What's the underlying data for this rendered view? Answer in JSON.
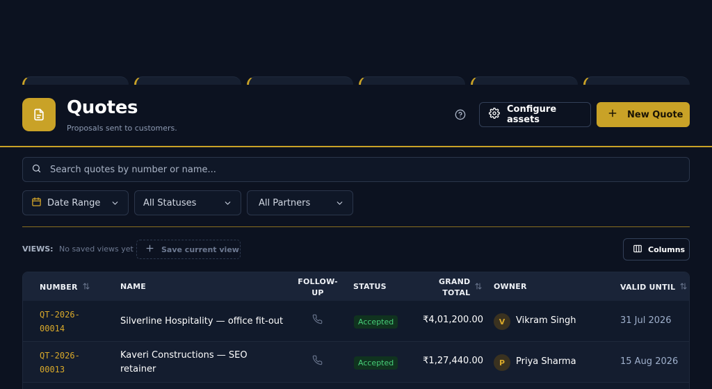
{
  "header": {
    "title": "Quotes",
    "subtitle": "Proposals sent to customers.",
    "configure_label": "Configure assets",
    "new_label": "New Quote"
  },
  "search": {
    "placeholder": "Search quotes by number or name..."
  },
  "filters": {
    "date": "Date Range",
    "status": "All Statuses",
    "partner": "All Partners"
  },
  "views": {
    "label": "VIEWS:",
    "empty": "No saved views yet",
    "save_label": "Save current view",
    "columns_label": "Columns"
  },
  "table": {
    "headers": {
      "number": "Number",
      "name": "Name",
      "follow_up_1": "Follow-",
      "follow_up_2": "up",
      "status": "Status",
      "total_1": "Grand",
      "total_2": "Total",
      "owner": "Owner",
      "valid": "Valid Until"
    },
    "rows": [
      {
        "number_1": "QT-2026-",
        "number_2": "00014",
        "name": "Silverline Hospitality — office fit-out",
        "status": "Accepted",
        "total": "₹4,01,200.00",
        "owner_initial": "V",
        "owner": "Vikram Singh",
        "valid": "31 Jul 2026"
      },
      {
        "number_1": "QT-2026-",
        "number_2": "00013",
        "name": "Kaveri Constructions — SEO retainer",
        "status": "Accepted",
        "total": "₹1,27,440.00",
        "owner_initial": "P",
        "owner": "Priya Sharma",
        "valid": "15 Aug 2026"
      }
    ]
  },
  "colors": {
    "accent": "#c9a227",
    "background": "#0c1220",
    "success": "#48d07a"
  }
}
